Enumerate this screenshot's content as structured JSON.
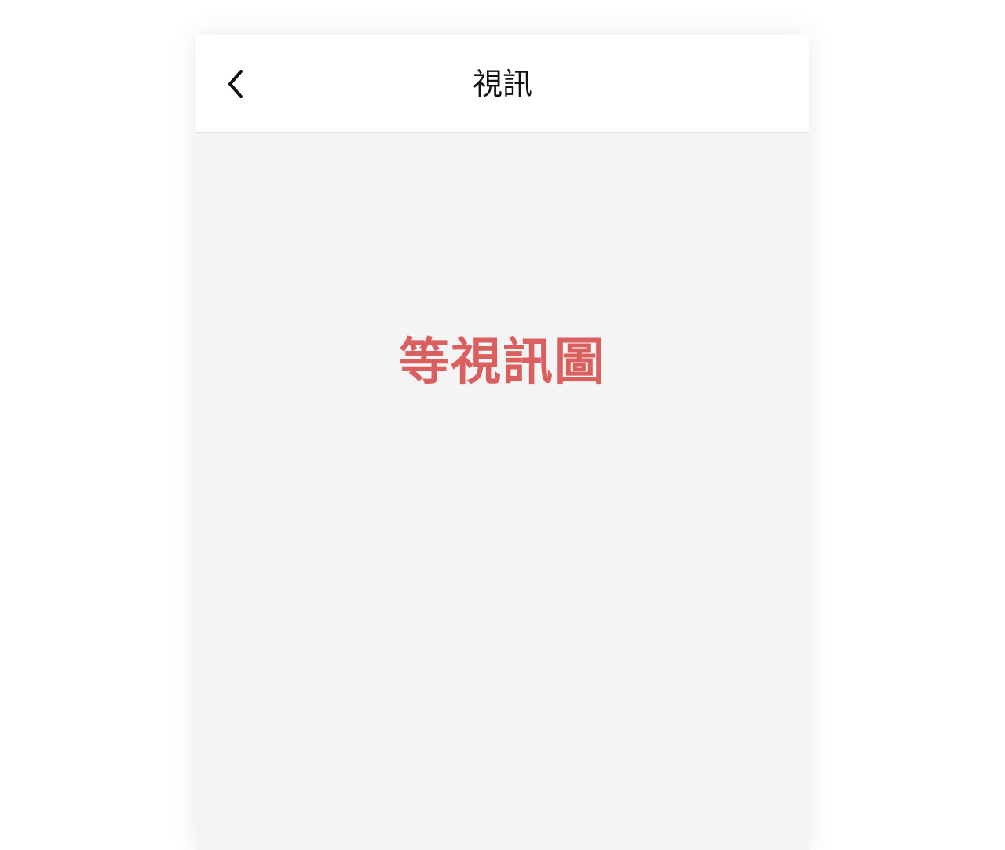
{
  "header": {
    "title": "視訊",
    "back_icon": "chevron-left-icon"
  },
  "main": {
    "placeholder_text": "等視訊圖"
  },
  "colors": {
    "header_background": "#ffffff",
    "content_background": "#f4f4f4",
    "title_text": "#111111",
    "placeholder_text": "#db5f5f"
  }
}
